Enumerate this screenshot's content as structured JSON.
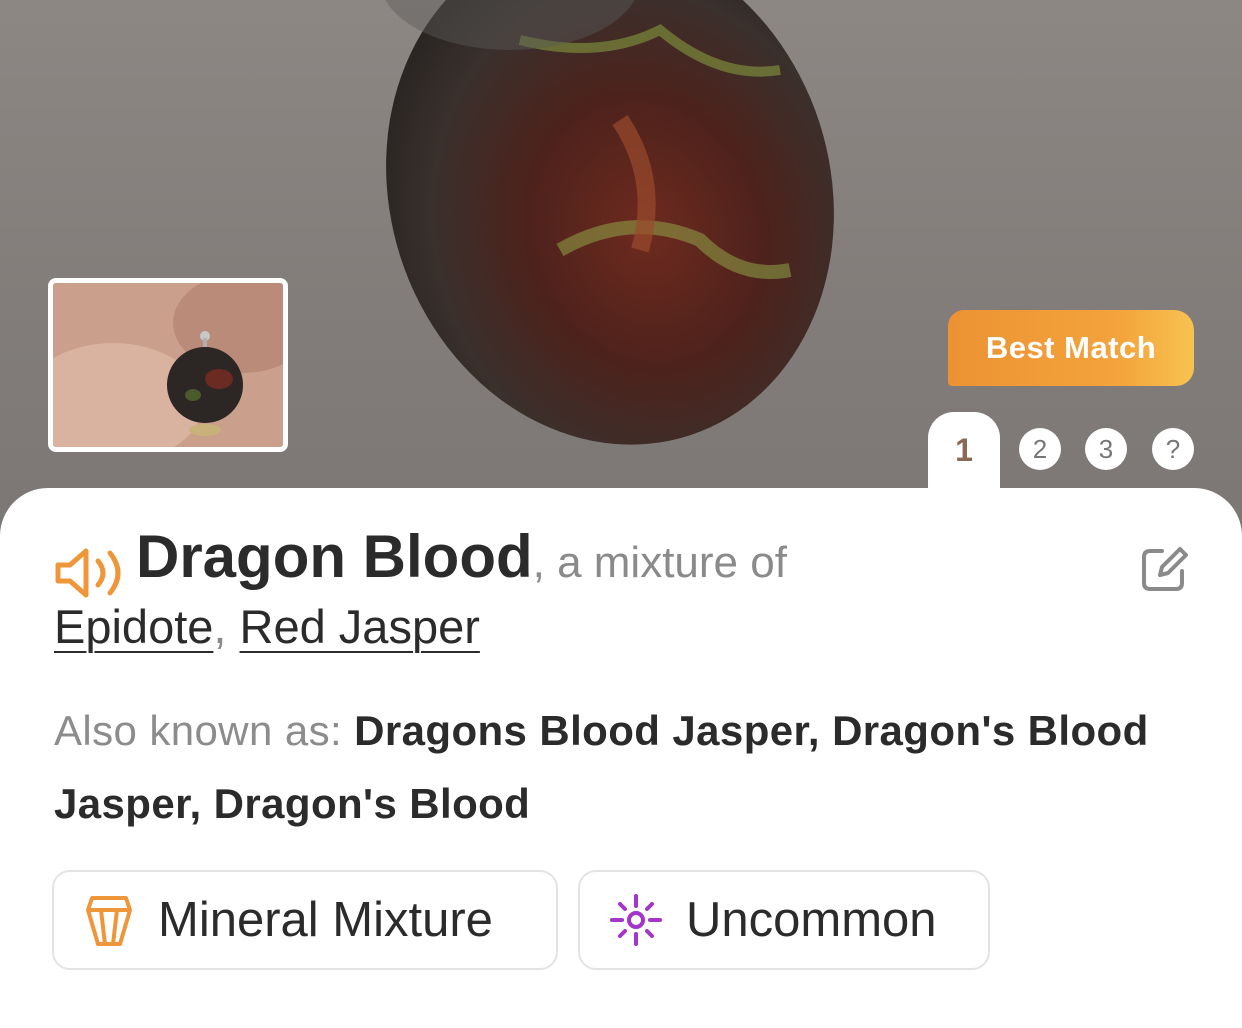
{
  "hero": {
    "badge": "Best Match",
    "active_page": "1",
    "pages": [
      "2",
      "3",
      "?"
    ]
  },
  "specimen": {
    "name": "Dragon Blood",
    "separator": ",",
    "mixture_text": " a mixture of",
    "components": [
      "Epidote",
      "Red Jasper"
    ],
    "components_separator": ",",
    "aka_label": "Also known as: ",
    "aka_value": "Dragons Blood Jasper, Dragon's Blood Jasper, Dragon's Blood"
  },
  "tags": [
    {
      "label": "Mineral Mixture",
      "icon": "crystal-icon"
    },
    {
      "label": "Uncommon",
      "icon": "sparkle-icon"
    }
  ],
  "colors": {
    "accent_orange": "#f0963a",
    "rarity_purple": "#a335c8",
    "text_dark": "#2b2b2b",
    "text_muted": "#8a8a8a"
  }
}
